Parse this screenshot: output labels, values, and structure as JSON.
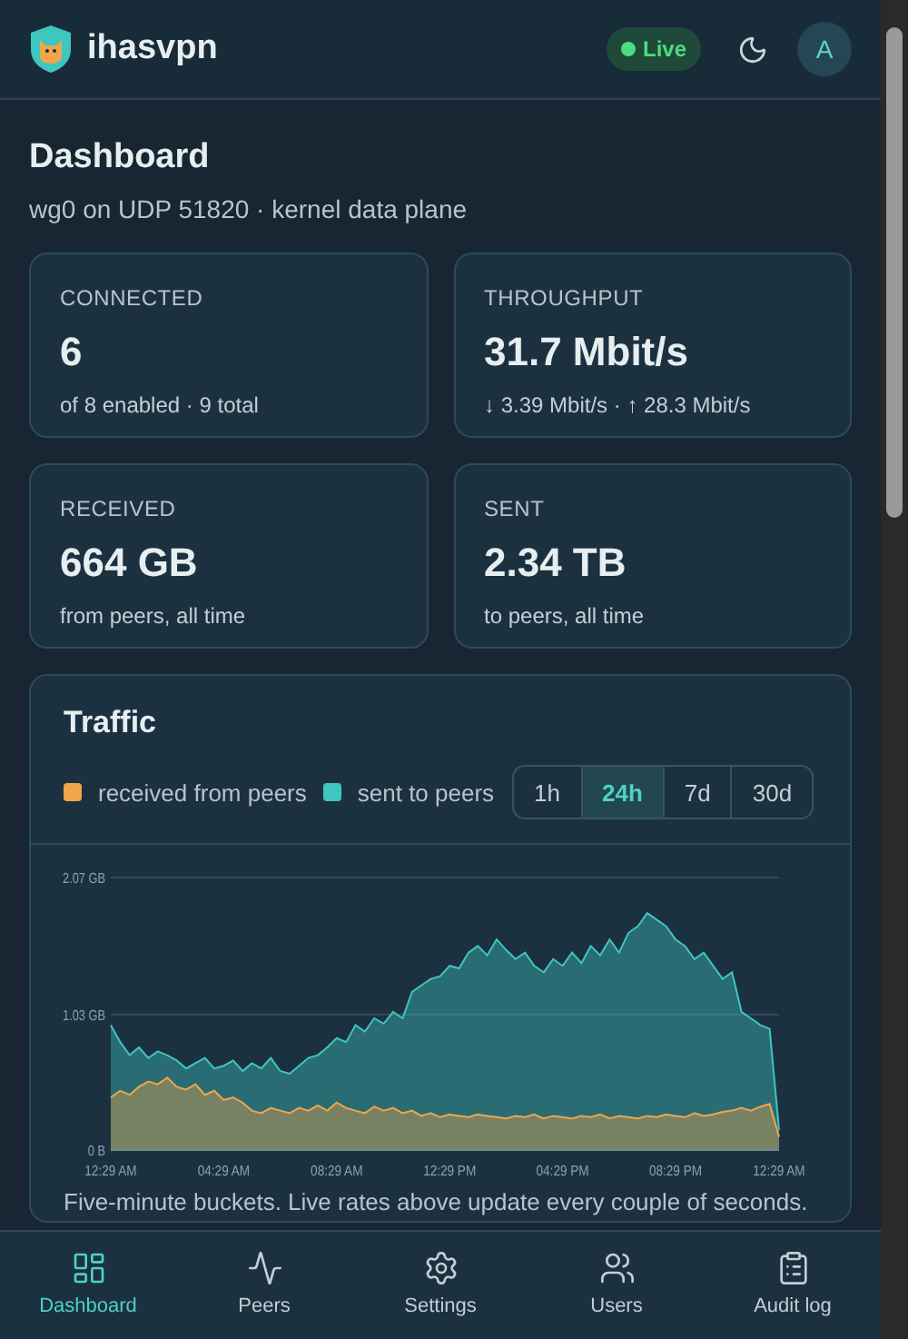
{
  "app": {
    "name": "ihasvpn",
    "status": {
      "label": "Live",
      "live": true
    },
    "avatar": "A"
  },
  "page": {
    "title": "Dashboard",
    "subtitle": "wg0 on UDP 51820 · kernel data plane"
  },
  "stats": [
    {
      "label": "CONNECTED",
      "value": "6",
      "note": "of 8 enabled · 9 total"
    },
    {
      "label": "THROUGHPUT",
      "value": "31.7 Mbit/s",
      "note": "↓ 3.39 Mbit/s · ↑ 28.3 Mbit/s"
    },
    {
      "label": "RECEIVED",
      "value": "664 GB",
      "note": "from peers, all time"
    },
    {
      "label": "SENT",
      "value": "2.34 TB",
      "note": "to peers, all time"
    }
  ],
  "traffic": {
    "title": "Traffic",
    "ranges": [
      {
        "label": "1h",
        "selected": false
      },
      {
        "label": "24h",
        "selected": true
      },
      {
        "label": "7d",
        "selected": false
      },
      {
        "label": "30d",
        "selected": false
      }
    ],
    "chart_data": {
      "type": "area",
      "stacked": false,
      "ylim": [
        0,
        2.07
      ],
      "categories": [
        "12:29 AM",
        null,
        null,
        null,
        null,
        null,
        null,
        null,
        null,
        null,
        null,
        null,
        "04:29 AM",
        null,
        null,
        null,
        null,
        null,
        null,
        null,
        null,
        null,
        null,
        null,
        "08:29 AM",
        null,
        null,
        null,
        null,
        null,
        null,
        null,
        null,
        null,
        null,
        null,
        "12:29 PM",
        null,
        null,
        null,
        null,
        null,
        null,
        null,
        null,
        null,
        null,
        null,
        "04:29 PM",
        null,
        null,
        null,
        null,
        null,
        null,
        null,
        null,
        null,
        null,
        null,
        "08:29 PM",
        null,
        null,
        null,
        null,
        null,
        null,
        null,
        null,
        null,
        null,
        "12:29 AM"
      ],
      "yticks": [
        {
          "value": 0,
          "label": "0 B"
        },
        {
          "value": 1.03,
          "label": "1.03 GB"
        },
        {
          "value": 2.07,
          "label": "2.07 GB"
        }
      ],
      "ref_lines": [
        {
          "axis": "y",
          "value": 1.03
        }
      ],
      "series": [
        {
          "name": "received from peers",
          "color": "#f0a64a",
          "values": [
            0.4,
            0.45,
            0.42,
            0.48,
            0.52,
            0.5,
            0.55,
            0.48,
            0.46,
            0.5,
            0.42,
            0.45,
            0.38,
            0.4,
            0.36,
            0.3,
            0.28,
            0.32,
            0.3,
            0.28,
            0.32,
            0.3,
            0.34,
            0.3,
            0.36,
            0.32,
            0.3,
            0.28,
            0.33,
            0.3,
            0.32,
            0.28,
            0.3,
            0.26,
            0.28,
            0.25,
            0.27,
            0.26,
            0.25,
            0.27,
            0.26,
            0.25,
            0.24,
            0.26,
            0.25,
            0.27,
            0.24,
            0.26,
            0.25,
            0.24,
            0.26,
            0.25,
            0.27,
            0.24,
            0.26,
            0.25,
            0.24,
            0.26,
            0.25,
            0.27,
            0.26,
            0.25,
            0.28,
            0.26,
            0.27,
            0.29,
            0.3,
            0.32,
            0.3,
            0.33,
            0.35,
            0.1
          ]
        },
        {
          "name": "sent to peers",
          "color": "#3ec6c0",
          "values": [
            0.95,
            0.82,
            0.72,
            0.78,
            0.7,
            0.75,
            0.72,
            0.68,
            0.62,
            0.66,
            0.7,
            0.62,
            0.64,
            0.68,
            0.6,
            0.66,
            0.62,
            0.7,
            0.6,
            0.58,
            0.64,
            0.7,
            0.72,
            0.78,
            0.85,
            0.82,
            0.95,
            0.9,
            1.0,
            0.96,
            1.05,
            1.0,
            1.2,
            1.25,
            1.3,
            1.32,
            1.4,
            1.38,
            1.5,
            1.55,
            1.48,
            1.6,
            1.52,
            1.45,
            1.5,
            1.4,
            1.35,
            1.45,
            1.4,
            1.5,
            1.42,
            1.55,
            1.48,
            1.6,
            1.5,
            1.65,
            1.7,
            1.8,
            1.75,
            1.7,
            1.6,
            1.55,
            1.45,
            1.5,
            1.4,
            1.3,
            1.35,
            1.05,
            1.0,
            0.95,
            0.92,
            0.15
          ]
        }
      ]
    },
    "footnote": "Five-minute buckets. Live rates above update every couple of seconds."
  },
  "nav": [
    {
      "label": "Dashboard",
      "kind": "dashboard",
      "selected": true
    },
    {
      "label": "Peers",
      "kind": "activity",
      "selected": false
    },
    {
      "label": "Settings",
      "kind": "settings",
      "selected": false
    },
    {
      "label": "Users",
      "kind": "users",
      "selected": false
    },
    {
      "label": "Audit log",
      "kind": "clipboard",
      "selected": false
    }
  ]
}
